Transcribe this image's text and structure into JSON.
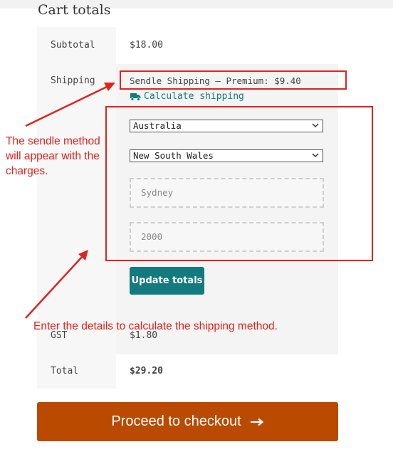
{
  "cart": {
    "title": "Cart totals",
    "rows": {
      "subtotal": {
        "label": "Subtotal",
        "value": "$18.00"
      },
      "shipping": {
        "label": "Shipping",
        "method": "Sendle Shipping – Premium: $9.40"
      },
      "gst": {
        "label": "GST",
        "value": "$1.80"
      },
      "total": {
        "label": "Total",
        "value": "$29.20"
      }
    },
    "calculate_shipping": {
      "label": "Calculate shipping",
      "icon": "truck-icon"
    },
    "form": {
      "country": "Australia",
      "state": "New South Wales",
      "city_placeholder": "Sydney",
      "postcode_placeholder": "2000",
      "update_label": "Update totals"
    },
    "checkout": {
      "label": "Proceed to checkout",
      "icon": "arrow-right-icon"
    }
  },
  "annotations": {
    "method_note": [
      "The sendle method",
      "will appear with the",
      "charges."
    ],
    "details_note": "Enter the details to calculate the shipping method."
  },
  "colors": {
    "accent": "#137a80",
    "checkout": "#b94a00",
    "annotation": "#e0231e"
  }
}
